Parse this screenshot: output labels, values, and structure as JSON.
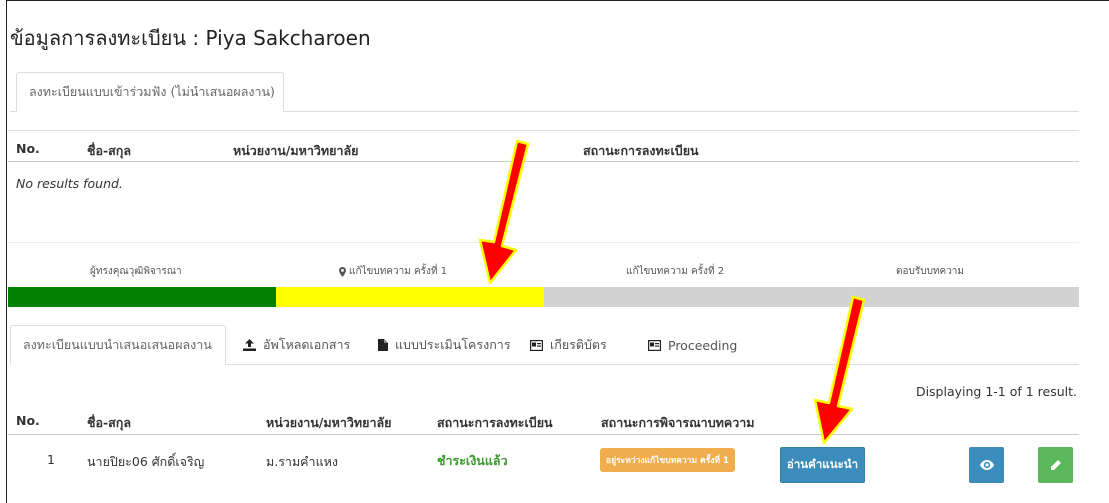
{
  "page_title": "ข้อมูลการลงทะเบียน : Piya Sakcharoen",
  "attendee_section": {
    "tab_label": "ลงทะเบียนแบบเข้าร่วมฟัง (ไม่นำเสนอผลงาน)",
    "columns": [
      "No.",
      "ชื่อ-สกุล",
      "หน่วยงาน/มหาวิทยาลัย",
      "สถานะการลงทะเบียน"
    ],
    "empty_text": "No results found."
  },
  "progress": {
    "steps": [
      "ผู้ทรงคุณวุฒิพิจารณา",
      "แก้ไขบทความ ครั้งที่ 1",
      "แก้ไขบทความ ครั้งที่ 2",
      "ตอบรับบทความ"
    ],
    "current_step_index": 1,
    "current_marker_icon": "map-marker-icon",
    "segment_colors": [
      "#008000",
      "#ffff00",
      "#d2d2d2",
      "#d2d2d2"
    ],
    "completed_fraction": 0.5
  },
  "presenter_tabs": [
    {
      "label": "ลงทะเบียนแบบนำเสนอเสนอผลงาน",
      "icon": null,
      "active": true
    },
    {
      "label": "อัพโหลดเอกสาร",
      "icon": "upload-icon",
      "active": false
    },
    {
      "label": "แบบประเมินโครงการ",
      "icon": "file-icon",
      "active": false
    },
    {
      "label": "เกียรติบัตร",
      "icon": "id-card-icon",
      "active": false
    },
    {
      "label": "Proceeding",
      "icon": "id-card-icon",
      "active": false
    }
  ],
  "presenter_section": {
    "display_count": "Displaying 1-1 of 1 result.",
    "columns": [
      "No.",
      "ชื่อ-สกุล",
      "หน่วยงาน/มหาวิทยาลัย",
      "สถานะการลงทะเบียน",
      "สถานะการพิจารณาบทความ"
    ],
    "rows": [
      {
        "no": "1",
        "name": "นายปิยะ06 ศักดิ์เจริญ",
        "org": "ม.รามคำแหง",
        "registration_status": "ชำระเงินแล้ว",
        "review_status": "อยู่ระหว่างแก้ไขบทความ ครั้งที่ 1",
        "read_button": "อ่านคำแนะนำ",
        "view_icon": "eye-icon",
        "edit_icon": "pencil-icon"
      }
    ]
  },
  "colors": {
    "primary_button": "#3c8dbc",
    "success_button": "#5cb85c",
    "warning_label": "#f0ad4e",
    "paid_text": "#3c9a2f",
    "annotation_arrow": "#ff0000",
    "annotation_outline": "#ffff00"
  }
}
